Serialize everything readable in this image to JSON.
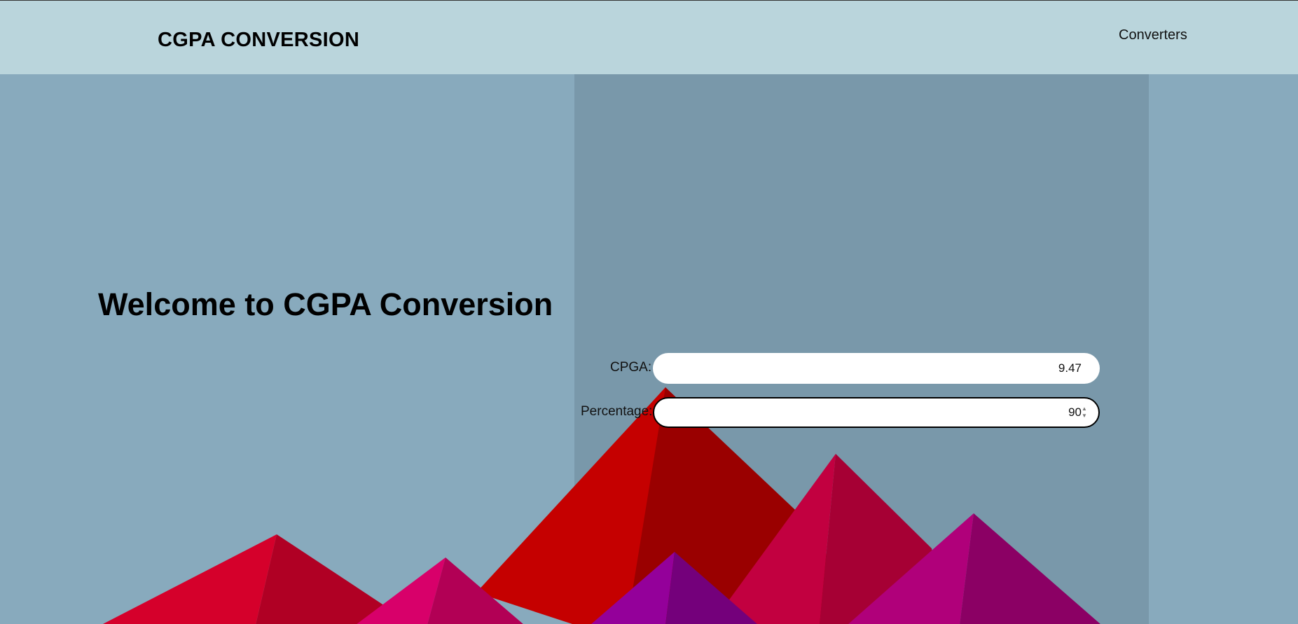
{
  "navbar": {
    "brand": "CGPA CONVERSION",
    "link": "Converters"
  },
  "hero": {
    "title": "Welcome to CGPA Conversion"
  },
  "form": {
    "cgpa_label": "CPGA:",
    "cgpa_value": "9.47",
    "percentage_label": "Percentage:",
    "percentage_value": "90"
  },
  "colors": {
    "navbar_bg": "#bad5dc",
    "page_bg": "#88aabd",
    "panel_bg": "#7998aa",
    "mountain_red": "#c80000",
    "mountain_crimson": "#d5002b",
    "mountain_pink": "#d6006a",
    "mountain_purple": "#950099"
  }
}
